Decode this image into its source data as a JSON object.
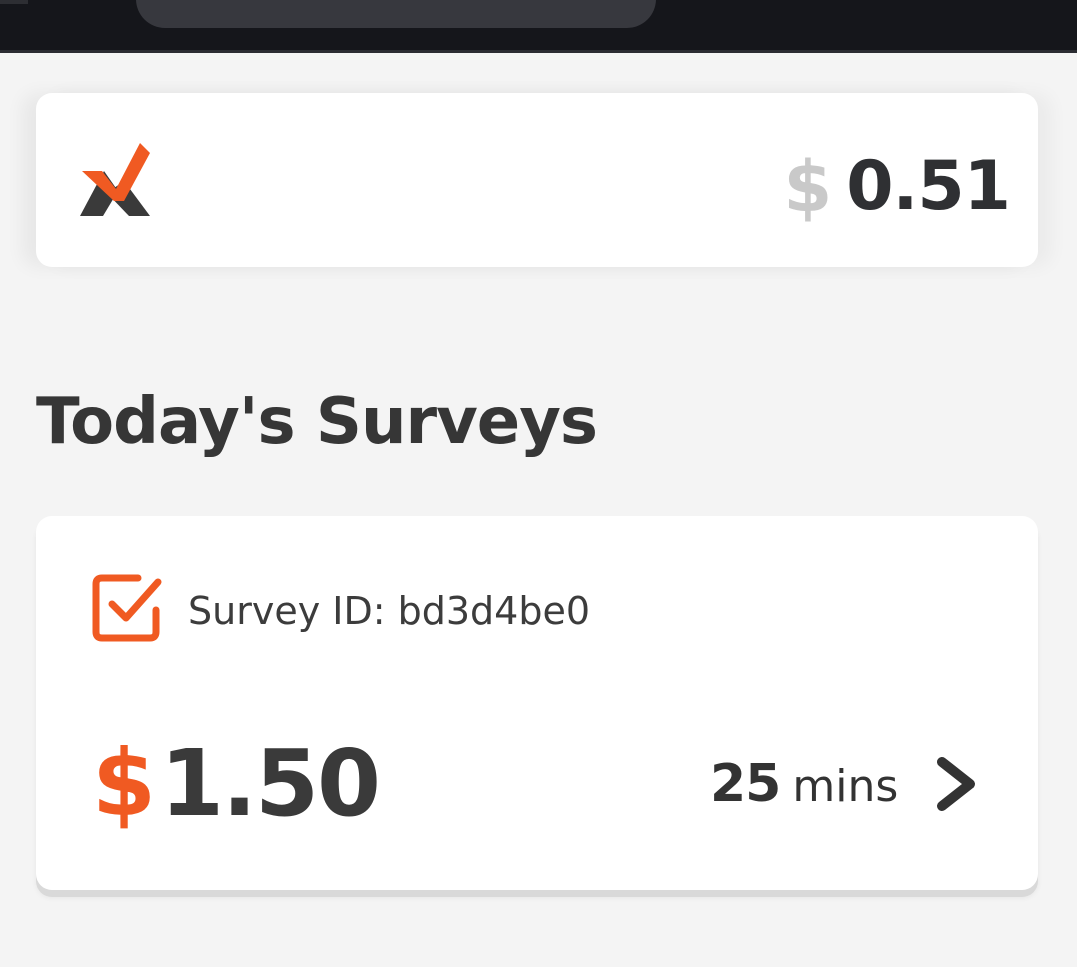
{
  "balance": {
    "currency_symbol": "$",
    "amount": "0.51",
    "logo_icon": "x-logo-icon"
  },
  "section": {
    "title": "Today's Surveys"
  },
  "survey": {
    "icon": "checkbox-checked-icon",
    "id_text": "Survey ID: bd3d4be0",
    "reward_currency": "$",
    "reward_amount": "1.50",
    "duration_value": "25",
    "duration_unit": "mins",
    "open_icon": "chevron-right-icon"
  },
  "colors": {
    "accent": "#f05a22",
    "dark_text": "#3a3a3a",
    "muted_currency": "#c9c9c9",
    "background": "#f4f4f4",
    "top_bar": "#15161b"
  }
}
